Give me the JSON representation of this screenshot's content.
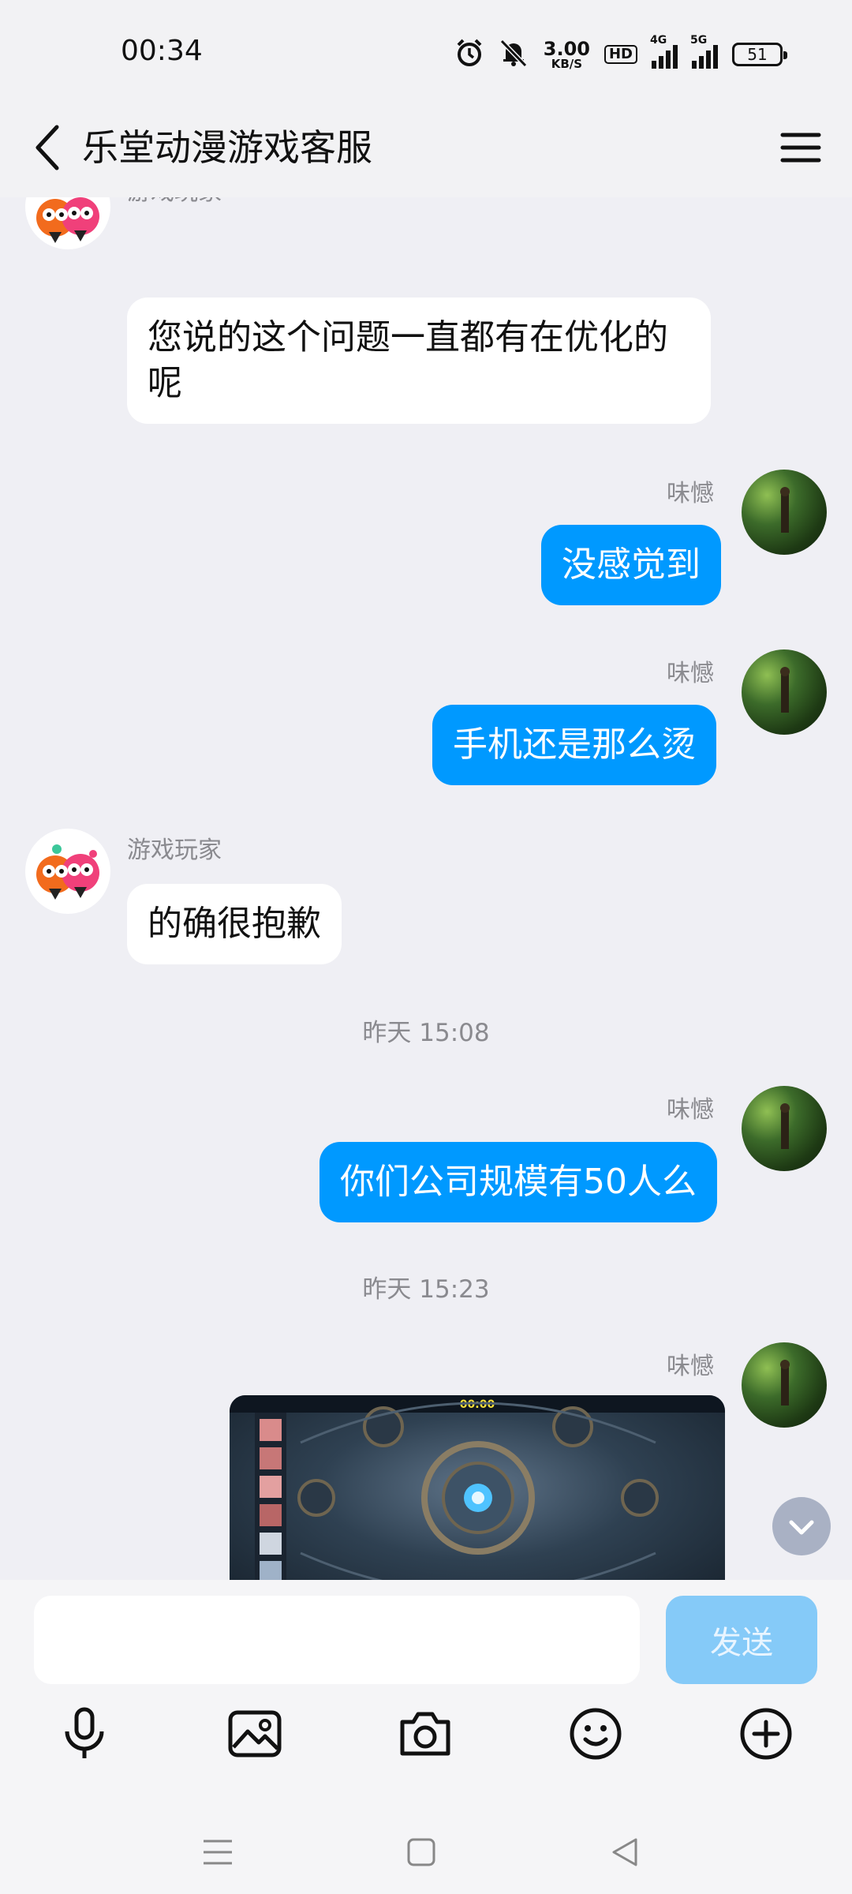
{
  "status_bar": {
    "time": "00:34",
    "net_speed_value": "3.00",
    "net_speed_unit": "KB/S",
    "hd_badge": "HD",
    "signal1_label": "4G",
    "signal2_label": "5G",
    "battery": "51"
  },
  "header": {
    "title": "乐堂动漫游戏客服",
    "back_icon": "chevron-left-icon",
    "menu_icon": "hamburger-menu-icon"
  },
  "chat": {
    "messages": [
      {
        "from": "bot",
        "sender": "游戏玩家",
        "text": "您说的这个问题一直都有在优化的呢"
      },
      {
        "from": "user",
        "sender": "味憾",
        "text": "没感觉到"
      },
      {
        "from": "user",
        "sender": "味憾",
        "text": "手机还是那么烫"
      },
      {
        "from": "bot",
        "sender": "游戏玩家",
        "text": "的确很抱歉"
      },
      {
        "timestamp": "昨天 15:08"
      },
      {
        "from": "user",
        "sender": "味憾",
        "text": "你们公司规模有50人么"
      },
      {
        "timestamp": "昨天 15:23"
      },
      {
        "from": "user",
        "sender": "味憾",
        "type": "image",
        "image_caption_time": "00:00"
      }
    ],
    "colors": {
      "outgoing": "#0099ff",
      "incoming": "#ffffff"
    }
  },
  "input": {
    "placeholder": "",
    "value": "",
    "send_label": "发送"
  },
  "toolbar": {
    "icons": [
      "microphone-icon",
      "image-icon",
      "camera-icon",
      "emoji-icon",
      "plus-icon"
    ]
  },
  "nav_bar": {
    "icons": [
      "recent-apps-icon",
      "home-icon",
      "back-icon"
    ]
  }
}
